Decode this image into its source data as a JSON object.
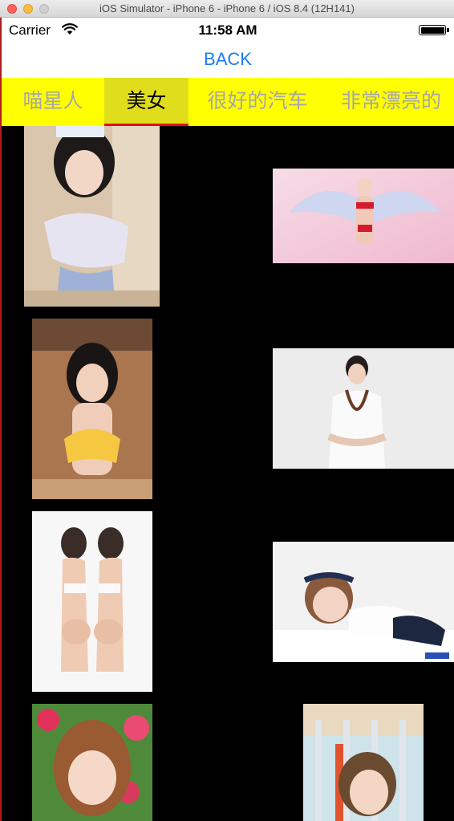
{
  "window": {
    "title": "iOS Simulator - iPhone 6 - iPhone 6 / iOS 8.4 (12H141)"
  },
  "statusbar": {
    "carrier": "Carrier",
    "time": "11:58 AM",
    "wifi_icon": "wifi-icon",
    "battery_icon": "battery-icon"
  },
  "navbar": {
    "back_label": "BACK",
    "accent_color": "#1a7cf4"
  },
  "tabs": {
    "background_color": "#ffff00",
    "active_color": "#e0de1c",
    "indicator_color": "#e01010",
    "items": [
      {
        "label": "喵星人",
        "active": false
      },
      {
        "label": "美女",
        "active": true
      },
      {
        "label": "很好的汽车",
        "active": false
      },
      {
        "label": "非常漂亮的"
      }
    ]
  },
  "grid": {
    "photos": [
      {
        "name": "photo-1"
      },
      {
        "name": "photo-2"
      },
      {
        "name": "photo-3"
      },
      {
        "name": "photo-4"
      },
      {
        "name": "photo-5"
      },
      {
        "name": "photo-6"
      },
      {
        "name": "photo-7"
      },
      {
        "name": "photo-8"
      }
    ]
  }
}
